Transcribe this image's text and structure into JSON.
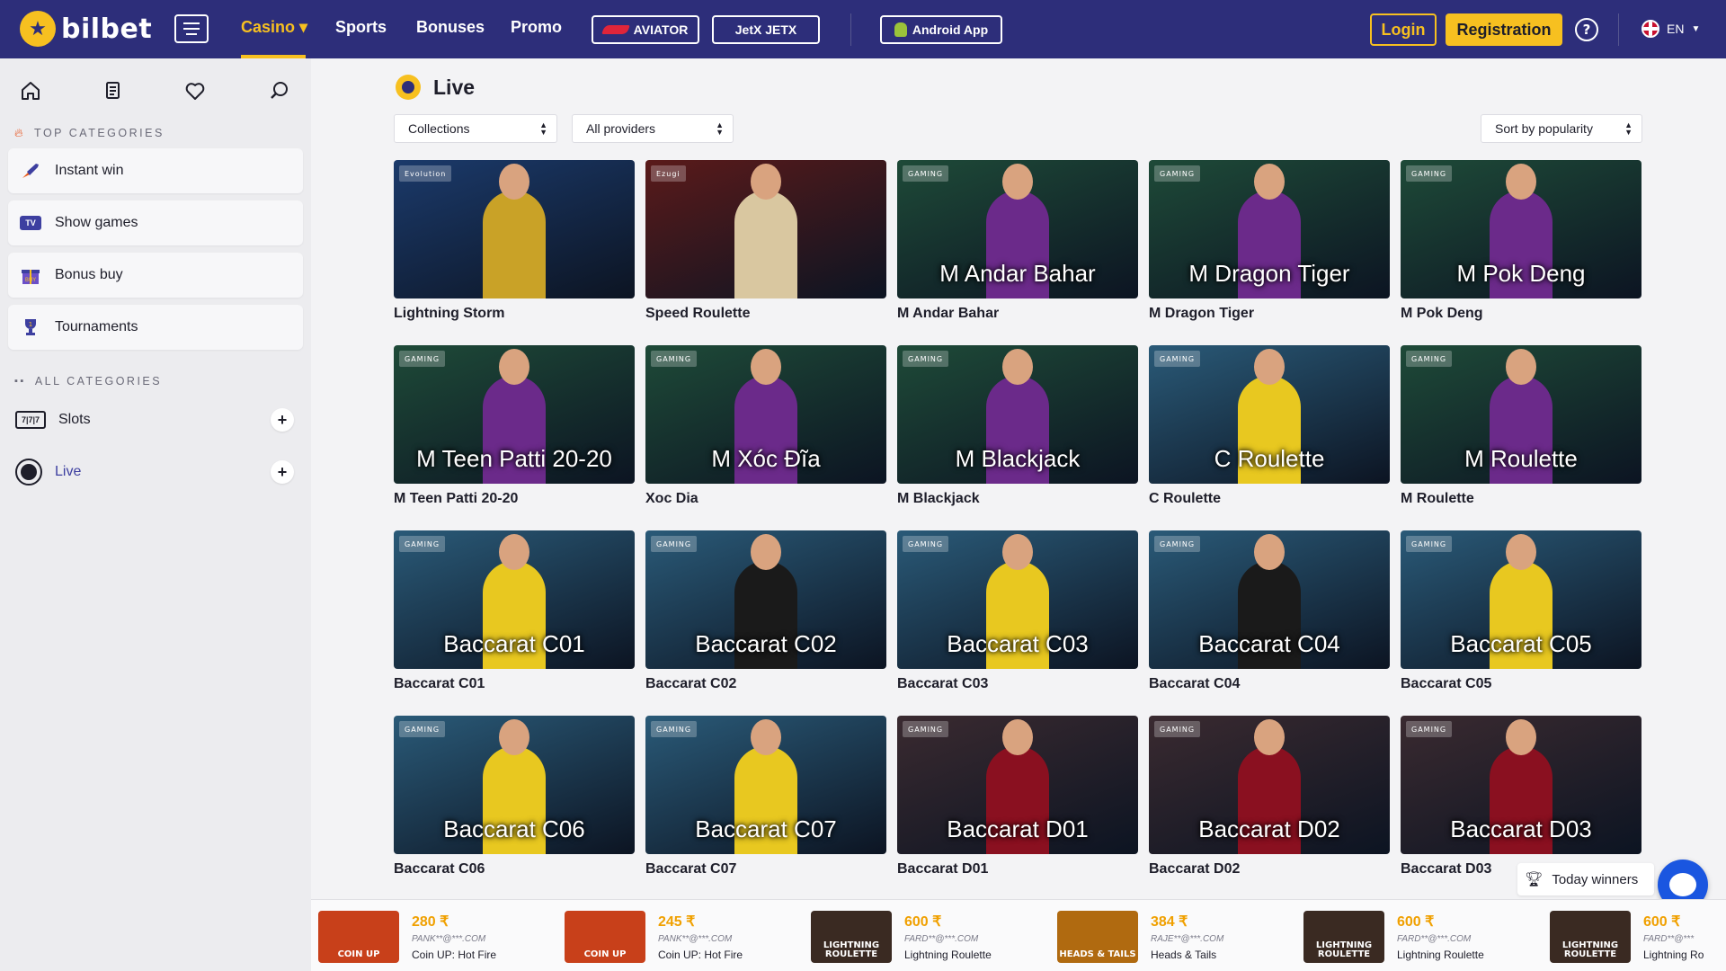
{
  "header": {
    "logo_text": "bilbet",
    "nav": [
      {
        "label": "Casino ▾"
      },
      {
        "label": "Sports"
      },
      {
        "label": "Bonuses"
      },
      {
        "label": "Promo"
      }
    ],
    "aviator_label": "AVIATOR",
    "jetx_label": "JetX JETX",
    "android_label": "Android App",
    "login_label": "Login",
    "registration_label": "Registration",
    "help_label": "?",
    "language": "EN"
  },
  "sidebar": {
    "icons": [
      "home-icon",
      "document-icon",
      "heart-icon",
      "search-icon"
    ],
    "top_categories_label": "TOP CATEGORIES",
    "top_categories": [
      {
        "label": "Instant win",
        "icon": "rocket-icon"
      },
      {
        "label": "Show games",
        "icon": "tv-icon"
      },
      {
        "label": "Bonus buy",
        "icon": "gift-icon"
      },
      {
        "label": "Tournaments",
        "icon": "trophy-icon"
      }
    ],
    "all_categories_label": "ALL CATEGORIES",
    "all_categories": [
      {
        "label": "Slots",
        "icon": "slots-icon",
        "badge": "7|7|7"
      },
      {
        "label": "Live",
        "icon": "live-icon"
      }
    ]
  },
  "main": {
    "title": "Live",
    "filters": {
      "collections": "Collections",
      "providers": "All providers",
      "sort": "Sort by popularity"
    },
    "games": [
      {
        "caption": "Lightning Storm",
        "overlay": "",
        "provider": "Evolution",
        "bg": "#1b3a6b",
        "accent": "#c9a227"
      },
      {
        "caption": "Speed Roulette",
        "overlay": "",
        "provider": "Ezugi",
        "bg": "#5a1a1a",
        "accent": "#d9c7a0"
      },
      {
        "caption": "M Andar Bahar",
        "overlay": "M Andar Bahar",
        "provider": "GAMING",
        "bg": "#1e4a38",
        "accent": "#6b2a8a"
      },
      {
        "caption": "M Dragon Tiger",
        "overlay": "M Dragon Tiger",
        "provider": "GAMING",
        "bg": "#1e4a38",
        "accent": "#6b2a8a"
      },
      {
        "caption": "M Pok Deng",
        "overlay": "M Pok Deng",
        "provider": "GAMING",
        "bg": "#1e4a38",
        "accent": "#6b2a8a"
      },
      {
        "caption": "M Teen Patti 20-20",
        "overlay": "M Teen Patti 20-20",
        "provider": "GAMING",
        "bg": "#1e4a38",
        "accent": "#6b2a8a"
      },
      {
        "caption": "Xoc Dia",
        "overlay": "M Xóc Đĩa",
        "provider": "GAMING",
        "bg": "#1e4a38",
        "accent": "#6b2a8a"
      },
      {
        "caption": "M Blackjack",
        "overlay": "M Blackjack",
        "provider": "GAMING",
        "bg": "#1e4a38",
        "accent": "#6b2a8a"
      },
      {
        "caption": "C Roulette",
        "overlay": "C Roulette",
        "provider": "GAMING",
        "bg": "#2a5a78",
        "accent": "#e8c820"
      },
      {
        "caption": "M Roulette",
        "overlay": "M Roulette",
        "provider": "GAMING",
        "bg": "#1e4a38",
        "accent": "#6b2a8a"
      },
      {
        "caption": "Baccarat C01",
        "overlay": "Baccarat C01",
        "provider": "GAMING",
        "bg": "#2a5a78",
        "accent": "#e8c820"
      },
      {
        "caption": "Baccarat C02",
        "overlay": "Baccarat C02",
        "provider": "GAMING",
        "bg": "#2a5a78",
        "accent": "#1a1a1a"
      },
      {
        "caption": "Baccarat C03",
        "overlay": "Baccarat C03",
        "provider": "GAMING",
        "bg": "#2a5a78",
        "accent": "#e8c820"
      },
      {
        "caption": "Baccarat C04",
        "overlay": "Baccarat C04",
        "provider": "GAMING",
        "bg": "#2a5a78",
        "accent": "#1a1a1a"
      },
      {
        "caption": "Baccarat C05",
        "overlay": "Baccarat C05",
        "provider": "GAMING",
        "bg": "#2a5a78",
        "accent": "#e8c820"
      },
      {
        "caption": "Baccarat C06",
        "overlay": "Baccarat C06",
        "provider": "GAMING",
        "bg": "#2a5a78",
        "accent": "#e8c820"
      },
      {
        "caption": "Baccarat C07",
        "overlay": "Baccarat C07",
        "provider": "GAMING",
        "bg": "#2a5a78",
        "accent": "#e8c820"
      },
      {
        "caption": "Baccarat D01",
        "overlay": "Baccarat D01",
        "provider": "GAMING",
        "bg": "#3a2a30",
        "accent": "#8a1020"
      },
      {
        "caption": "Baccarat D02",
        "overlay": "Baccarat D02",
        "provider": "GAMING",
        "bg": "#3a2a30",
        "accent": "#8a1020"
      },
      {
        "caption": "Baccarat D03",
        "overlay": "Baccarat D03",
        "provider": "GAMING",
        "bg": "#3a2a30",
        "accent": "#8a1020"
      }
    ]
  },
  "winners": {
    "today_label": "Today winners",
    "items": [
      {
        "amount": "280 ₹",
        "user": "PANK**@***.COM",
        "game": "Coin UP: Hot Fire",
        "img_label": "COIN UP",
        "img_bg": "#c8401a"
      },
      {
        "amount": "245 ₹",
        "user": "PANK**@***.COM",
        "game": "Coin UP: Hot Fire",
        "img_label": "COIN UP",
        "img_bg": "#c8401a"
      },
      {
        "amount": "600 ₹",
        "user": "FARD**@***.COM",
        "game": "Lightning Roulette",
        "img_label": "LIGHTNING ROULETTE",
        "img_bg": "#3a2a22"
      },
      {
        "amount": "384 ₹",
        "user": "RAJE**@***.COM",
        "game": "Heads & Tails",
        "img_label": "HEADS & TAILS",
        "img_bg": "#b06a10"
      },
      {
        "amount": "600 ₹",
        "user": "FARD**@***.COM",
        "game": "Lightning Roulette",
        "img_label": "LIGHTNING ROULETTE",
        "img_bg": "#3a2a22"
      },
      {
        "amount": "600 ₹",
        "user": "FARD**@***",
        "game": "Lightning Ro",
        "img_label": "LIGHTNING ROULETTE",
        "img_bg": "#3a2a22"
      }
    ]
  }
}
